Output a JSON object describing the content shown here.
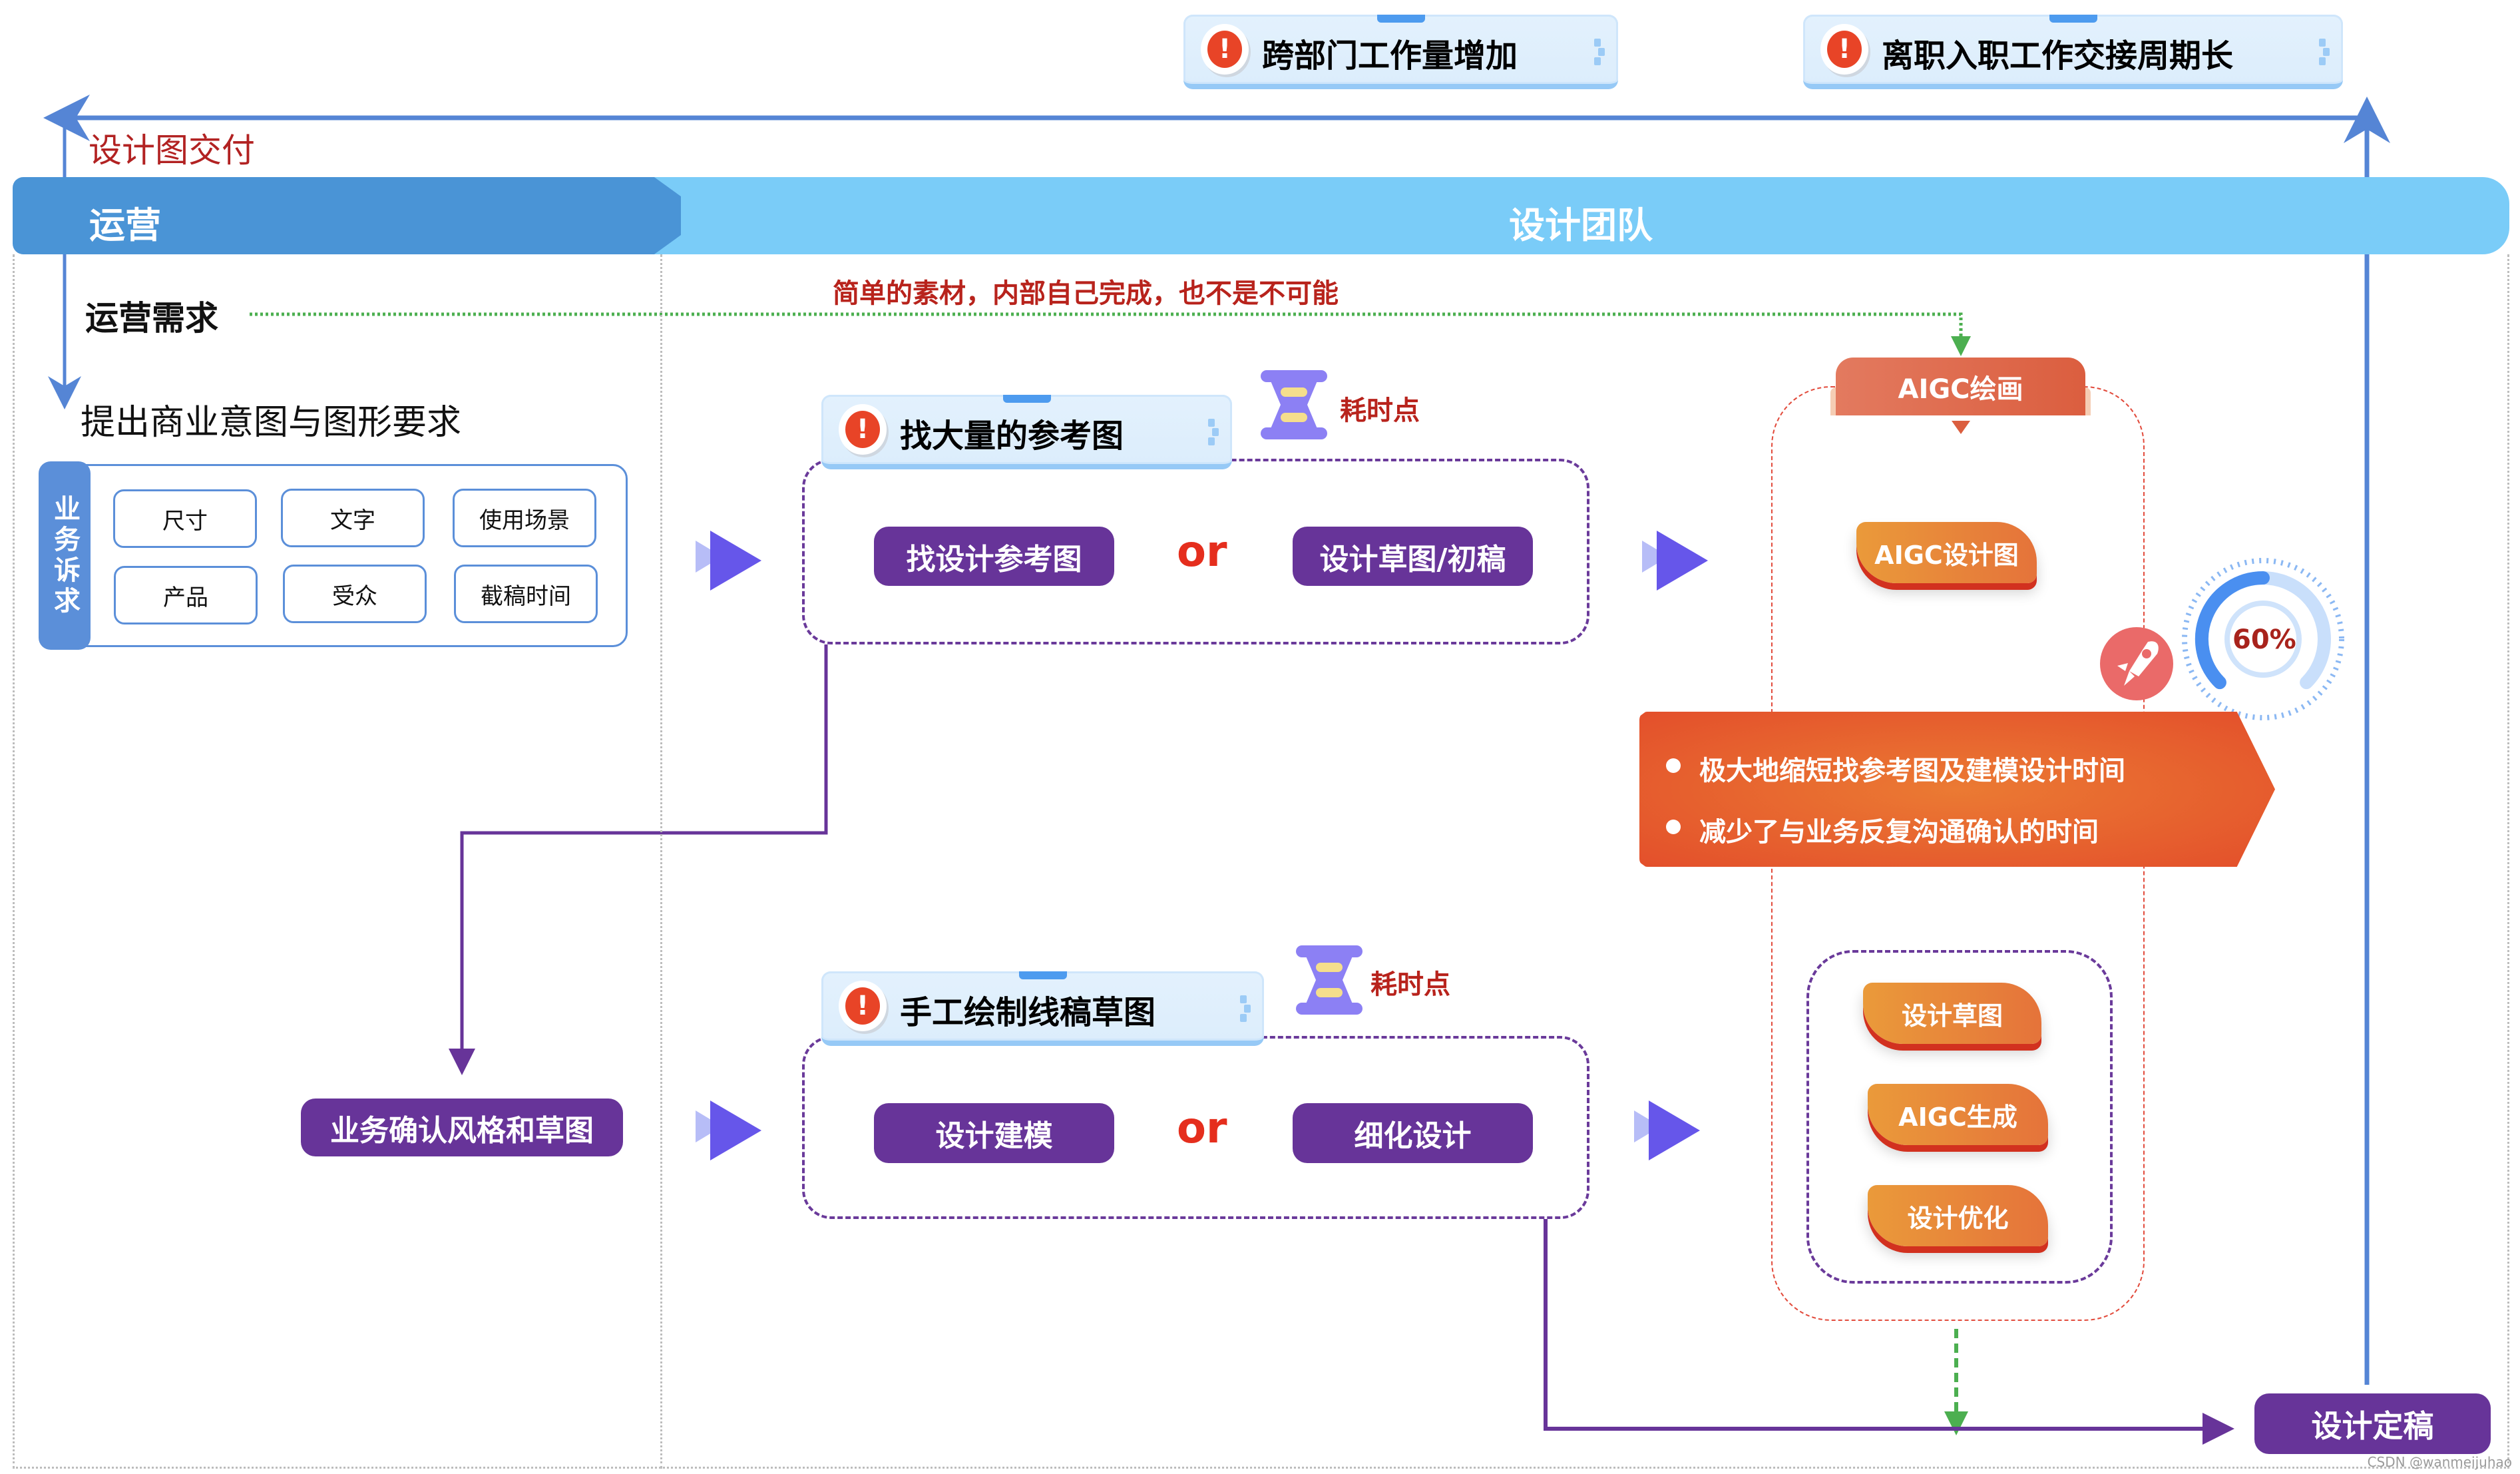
{
  "top_issues": [
    {
      "label": "跨部门工作量增加",
      "icon": "warning-icon"
    },
    {
      "label": "离职入职工作交接周期长",
      "icon": "warning-icon"
    }
  ],
  "delivery_label": "设计图交付",
  "lanes": {
    "operations": "运营",
    "design_team": "设计团队"
  },
  "operations": {
    "requirement_title": "运营需求",
    "request_text": "提出商业意图与图形要求",
    "business_appeal": {
      "side_label": "业务诉求",
      "items": [
        "尺寸",
        "文字",
        "使用场景",
        "产品",
        "受众",
        "截稿时间"
      ]
    },
    "confirm_button": "业务确认风格和草图"
  },
  "shortcut_note": "简单的素材，内部自己完成，也不是不可能",
  "traditional_flow": [
    {
      "issue": "找大量的参考图",
      "time_cost_label": "耗时点",
      "options": [
        "找设计参考图",
        "设计草图/初稿"
      ],
      "separator": "or"
    },
    {
      "issue": "手工绘制线稿草图",
      "time_cost_label": "耗时点",
      "options": [
        "设计建模",
        "细化设计"
      ],
      "separator": "or"
    }
  ],
  "aigc": {
    "title": "AIGC绘画",
    "first_step": "AIGC设计图",
    "efficiency_percent": 60,
    "efficiency_label": "60%",
    "benefits": [
      "极大地缩短找参考图及建模设计时间",
      "减少了与业务反复沟通确认的时间"
    ],
    "steps": [
      "设计草图",
      "AIGC生成",
      "设计优化"
    ]
  },
  "final_button": "设计定稿",
  "watermark": "CSDN @wanmeijuhao",
  "colors": {
    "header_dark": "#4A94D6",
    "header_light": "#7ACCF8",
    "flow_blue": "#5585D5",
    "purple": "#673499",
    "accent_red": "#E52E1D",
    "green_dotted": "#4CAF50",
    "orange": "#E5733A"
  }
}
